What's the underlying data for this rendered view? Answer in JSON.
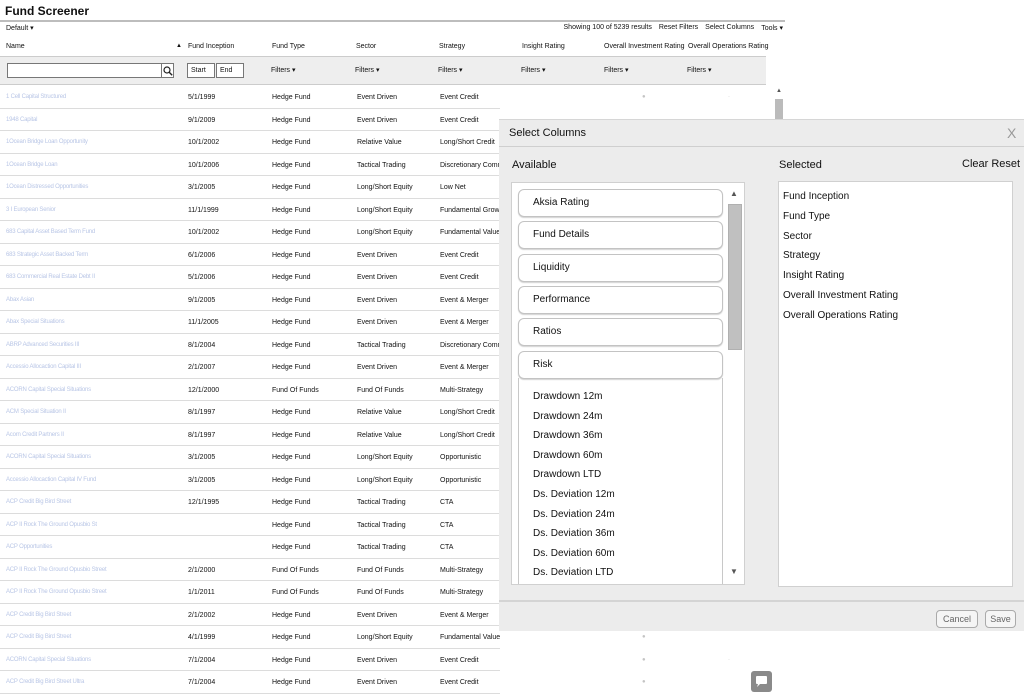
{
  "title": "Fund Screener",
  "default_label": "Default",
  "toolbar": {
    "results": "Showing 100 of 5239 results",
    "reset_filters": "Reset Filters",
    "select_columns": "Select Columns",
    "tools": "Tools"
  },
  "columns": {
    "name": "Name",
    "fund_inception": "Fund Inception",
    "fund_type": "Fund Type",
    "sector": "Sector",
    "strategy": "Strategy",
    "insight_rating": "Insight Rating",
    "overall_investment_rating": "Overall Investment Rating",
    "overall_operations_rating": "Overall Operations Rating"
  },
  "filters": {
    "start": "Start",
    "end": "End",
    "filters_label": "Filters"
  },
  "rows": [
    {
      "name": "1 Cell Capital Structured",
      "inception": "5/1/1999",
      "type": "Hedge Fund",
      "sector": "Event Driven",
      "strategy": "Event Credit"
    },
    {
      "name": "1948 Capital",
      "inception": "9/1/2009",
      "type": "Hedge Fund",
      "sector": "Event Driven",
      "strategy": "Event Credit"
    },
    {
      "name": "1Ocean Bridge Loan Opportunity",
      "inception": "10/1/2002",
      "type": "Hedge Fund",
      "sector": "Relative Value",
      "strategy": "Long/Short Credit"
    },
    {
      "name": "1Ocean Bridge Loan",
      "inception": "10/1/2006",
      "type": "Hedge Fund",
      "sector": "Tactical Trading",
      "strategy": "Discretionary Comm"
    },
    {
      "name": "1Ocean Distressed Opportunities",
      "inception": "3/1/2005",
      "type": "Hedge Fund",
      "sector": "Long/Short Equity",
      "strategy": "Low Net"
    },
    {
      "name": "3 I European Senior",
      "inception": "11/1/1999",
      "type": "Hedge Fund",
      "sector": "Long/Short Equity",
      "strategy": "Fundamental Growth"
    },
    {
      "name": "683 Capital Asset Based Term Fund",
      "inception": "10/1/2002",
      "type": "Hedge Fund",
      "sector": "Long/Short Equity",
      "strategy": "Fundamental Value"
    },
    {
      "name": "683 Strategic Asset Backed Term",
      "inception": "6/1/2006",
      "type": "Hedge Fund",
      "sector": "Event Driven",
      "strategy": "Event Credit"
    },
    {
      "name": "683 Commercial Real Estate Debt II",
      "inception": "5/1/2006",
      "type": "Hedge Fund",
      "sector": "Event Driven",
      "strategy": "Event Credit"
    },
    {
      "name": "Abax Asian",
      "inception": "9/1/2005",
      "type": "Hedge Fund",
      "sector": "Event Driven",
      "strategy": "Event & Merger"
    },
    {
      "name": "Abax Special Situations",
      "inception": "11/1/2005",
      "type": "Hedge Fund",
      "sector": "Event Driven",
      "strategy": "Event & Merger"
    },
    {
      "name": "ABRP Advanced Securities III",
      "inception": "8/1/2004",
      "type": "Hedge Fund",
      "sector": "Tactical Trading",
      "strategy": "Discretionary Comm"
    },
    {
      "name": "Accessio Allocaction Capital III",
      "inception": "2/1/2007",
      "type": "Hedge Fund",
      "sector": "Event Driven",
      "strategy": "Event & Merger"
    },
    {
      "name": "ACORN Capital Special Situations",
      "inception": "12/1/2000",
      "type": "Fund Of Funds",
      "sector": "Fund Of Funds",
      "strategy": "Multi-Strategy"
    },
    {
      "name": "ACM Special Situation II",
      "inception": "8/1/1997",
      "type": "Hedge Fund",
      "sector": "Relative Value",
      "strategy": "Long/Short Credit"
    },
    {
      "name": "Acorn Credit Partners II",
      "inception": "8/1/1997",
      "type": "Hedge Fund",
      "sector": "Relative Value",
      "strategy": "Long/Short Credit"
    },
    {
      "name": "ACORN Capital Special Situations",
      "inception": "3/1/2005",
      "type": "Hedge Fund",
      "sector": "Long/Short Equity",
      "strategy": "Opportunistic"
    },
    {
      "name": "Accessio Allocaction Capital IV Fund",
      "inception": "3/1/2005",
      "type": "Hedge Fund",
      "sector": "Long/Short Equity",
      "strategy": "Opportunistic"
    },
    {
      "name": "ACP Credit Big Bird Street",
      "inception": "12/1/1995",
      "type": "Hedge Fund",
      "sector": "Tactical Trading",
      "strategy": "CTA"
    },
    {
      "name": "ACP II Rock The Ground Opusbio St",
      "inception": "",
      "type": "Hedge Fund",
      "sector": "Tactical Trading",
      "strategy": "CTA"
    },
    {
      "name": "ACP Opportunities",
      "inception": "",
      "type": "Hedge Fund",
      "sector": "Tactical Trading",
      "strategy": "CTA"
    },
    {
      "name": "ACP II Rock The Ground Opusbio Street",
      "inception": "2/1/2000",
      "type": "Fund Of Funds",
      "sector": "Fund Of Funds",
      "strategy": "Multi-Strategy"
    },
    {
      "name": "ACP II Rock The Ground Opusbio Street",
      "inception": "1/1/2011",
      "type": "Fund Of Funds",
      "sector": "Fund Of Funds",
      "strategy": "Multi-Strategy"
    },
    {
      "name": "ACP Credit Big Bird Street",
      "inception": "2/1/2002",
      "type": "Hedge Fund",
      "sector": "Event Driven",
      "strategy": "Event & Merger"
    },
    {
      "name": "ACP Credit Big Bird Street",
      "inception": "4/1/1999",
      "type": "Hedge Fund",
      "sector": "Long/Short Equity",
      "strategy": "Fundamental Value"
    },
    {
      "name": "ACORN Capital Special Situations",
      "inception": "7/1/2004",
      "type": "Hedge Fund",
      "sector": "Event Driven",
      "strategy": "Event Credit"
    },
    {
      "name": "ACP Credit Big Bird Street Ultra",
      "inception": "7/1/2004",
      "type": "Hedge Fund",
      "sector": "Event Driven",
      "strategy": "Event Credit"
    }
  ],
  "modal": {
    "title": "Select Columns",
    "close": "X",
    "available_label": "Available",
    "selected_label": "Selected",
    "clear_reset": "Clear Reset",
    "groups": [
      "Aksia Rating",
      "Fund Details",
      "Liquidity",
      "Performance",
      "Ratios",
      "Risk"
    ],
    "risk_items": [
      "Drawdown 12m",
      "Drawdown 24m",
      "Drawdown 36m",
      "Drawdown 60m",
      "Drawdown LTD",
      "Ds. Deviation 12m",
      "Ds. Deviation 24m",
      "Ds. Deviation 36m",
      "Ds. Deviation 60m",
      "Ds. Deviation LTD"
    ],
    "selected_items": [
      "Fund Inception",
      "Fund Type",
      "Sector",
      "Strategy",
      "Insight Rating",
      "Overall Investment Rating",
      "Overall Operations Rating"
    ],
    "cancel": "Cancel",
    "save": "Save"
  }
}
